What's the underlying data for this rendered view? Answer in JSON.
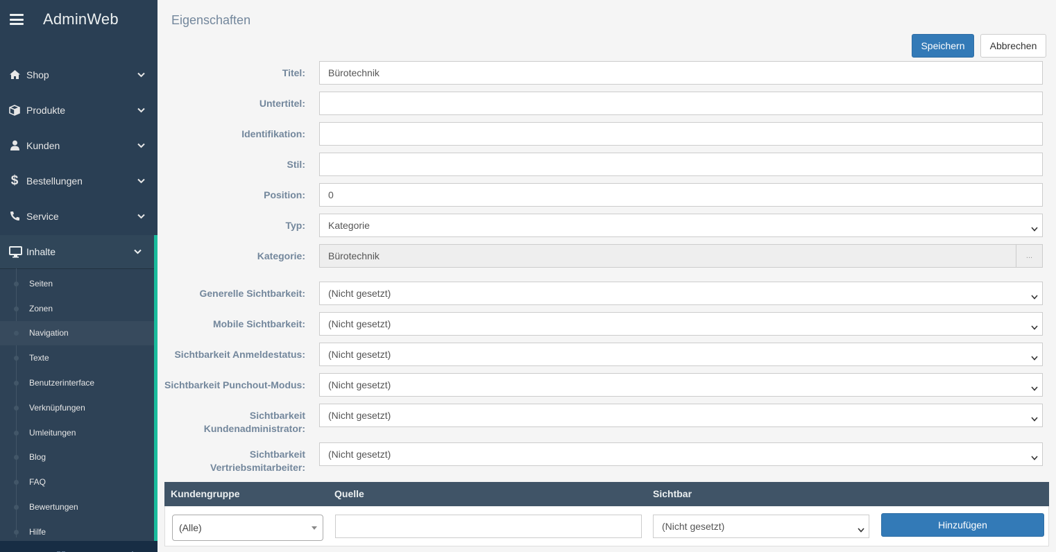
{
  "app": {
    "title": "AdminWeb"
  },
  "sidebar": {
    "items": [
      {
        "label": "Shop",
        "icon": "home-icon"
      },
      {
        "label": "Produkte",
        "icon": "cube-icon"
      },
      {
        "label": "Kunden",
        "icon": "user-icon"
      },
      {
        "label": "Bestellungen",
        "icon": "dollar-icon"
      },
      {
        "label": "Service",
        "icon": "phone-icon"
      }
    ],
    "active_group": {
      "label": "Inhalte",
      "icon": "monitor-icon"
    },
    "subitems": [
      {
        "label": "Seiten"
      },
      {
        "label": "Zonen"
      },
      {
        "label": "Navigation",
        "current": true
      },
      {
        "label": "Texte"
      },
      {
        "label": "Benutzerinterface"
      },
      {
        "label": "Verknüpfungen"
      },
      {
        "label": "Umleitungen"
      },
      {
        "label": "Blog"
      },
      {
        "label": "FAQ"
      },
      {
        "label": "Bewertungen"
      },
      {
        "label": "Hilfe"
      }
    ],
    "footer_icons": [
      "gear-icon",
      "expand-icon",
      "eye-slash-icon",
      "power-icon"
    ]
  },
  "page": {
    "title": "Eigenschaften",
    "save_label": "Speichern",
    "cancel_label": "Abbrechen"
  },
  "form": {
    "titel": {
      "label": "Titel:",
      "value": "Bürotechnik"
    },
    "untertitel": {
      "label": "Untertitel:",
      "value": ""
    },
    "identifikation": {
      "label": "Identifikation:",
      "value": ""
    },
    "stil": {
      "label": "Stil:",
      "value": ""
    },
    "position": {
      "label": "Position:",
      "value": "0"
    },
    "typ": {
      "label": "Typ:",
      "value": "Kategorie"
    },
    "kategorie": {
      "label": "Kategorie:",
      "value": "Bürotechnik",
      "addon": "..."
    },
    "generelle": {
      "label": "Generelle Sichtbarkeit:",
      "value": "(Nicht gesetzt)"
    },
    "mobile": {
      "label": "Mobile Sichtbarkeit:",
      "value": "(Nicht gesetzt)"
    },
    "anmeldestatus": {
      "label": "Sichtbarkeit Anmeldestatus:",
      "value": "(Nicht gesetzt)"
    },
    "punchout": {
      "label": "Sichtbarkeit Punchout-Modus:",
      "value": "(Nicht gesetzt)"
    },
    "kundenadmin": {
      "label_line1": "Sichtbarkeit",
      "label_line2": "Kundenadministrator:",
      "value": "(Nicht gesetzt)"
    },
    "vertrieb": {
      "label_line1": "Sichtbarkeit",
      "label_line2": "Vertriebsmitarbeiter:",
      "value": "(Nicht gesetzt)"
    }
  },
  "table": {
    "headers": {
      "kundengruppe": "Kundengruppe",
      "quelle": "Quelle",
      "sichtbar": "Sichtbar"
    },
    "row": {
      "kundengruppe": "(Alle)",
      "quelle": "",
      "sichtbar": "(Nicht gesetzt)",
      "add_label": "Hinzufügen"
    }
  },
  "colors": {
    "sidebar_bg": "#2a3f54",
    "accent": "#1abb9c",
    "primary": "#337ab7",
    "label": "#73879c",
    "table_header": "#405467"
  }
}
